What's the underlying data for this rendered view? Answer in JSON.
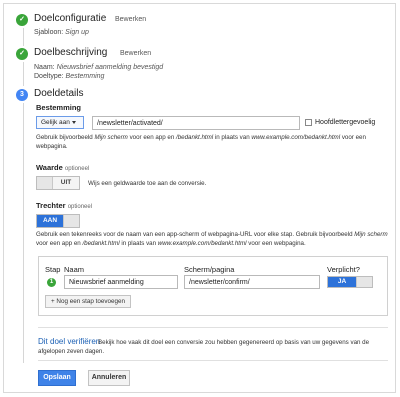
{
  "step1": {
    "number": "✓",
    "title": "Doelconfiguratie",
    "edit": "Bewerken",
    "meta_label": "Sjabloon:",
    "meta_value": "Sign up"
  },
  "step2": {
    "number": "✓",
    "title": "Doelbeschrijving",
    "edit": "Bewerken",
    "name_label": "Naam:",
    "name_value": "Nieuwsbrief aanmelding bevestigd",
    "type_label": "Doeltype:",
    "type_value": "Bestemming"
  },
  "step3": {
    "number": "3",
    "title": "Doeldetails"
  },
  "destination": {
    "label": "Bestemming",
    "match_select": "Gelijk aan",
    "url_value": "/newsletter/activated/",
    "case_sensitive_label": "Hoofdlettergevoelig",
    "help_1": "Gebruik bijvoorbeeld ",
    "help_1_italic": "Mijn scherm",
    "help_2": " voor een app en ",
    "help_2_italic": "/bedankt.html",
    "help_3": " in plaats van ",
    "help_3_italic": "www.example.com/bedankt.html",
    "help_4": " voor een webpagina."
  },
  "value": {
    "label": "Waarde",
    "optional": "optioneel",
    "toggle_text": "UIT",
    "help": "Wijs een geldwaarde toe aan de conversie."
  },
  "funnel": {
    "label": "Trechter",
    "optional": "optioneel",
    "toggle_text": "AAN",
    "help_a": "Gebruik een tekenreeks voor de naam van een app-scherm of webpagina-URL voor elke stap. Gebruik bijvoorbeeld ",
    "help_a_italic": "Mijn scherm",
    "help_b": " voor een app en ",
    "help_b_italic": "/bedankt.html",
    "help_c": " in plaats van ",
    "help_c_italic": "www.example.com/bedankt.html",
    "help_d": " voor een webpagina.",
    "col_step": "Stap",
    "col_name": "Naam",
    "col_screen": "Scherm/pagina",
    "col_required": "Verplicht?",
    "row_number": "1",
    "row_name": "Nieuwsbrief aanmelding",
    "row_screen": "/newsletter/confirm/",
    "row_required": "JA",
    "add_step": "+ Nog een stap toevoegen"
  },
  "verify": {
    "link": "Dit doel verifiëren",
    "help": "Bekijk hoe vaak dit doel een conversie zou hebben gegenereerd op basis van uw gegevens van de afgelopen zeven dagen."
  },
  "actions": {
    "save": "Opslaan",
    "cancel": "Annuleren"
  },
  "colors": {
    "success": "#3aa53a",
    "accent": "#4285f4",
    "link": "#1a5fb4",
    "primary": "#3f83e8"
  }
}
